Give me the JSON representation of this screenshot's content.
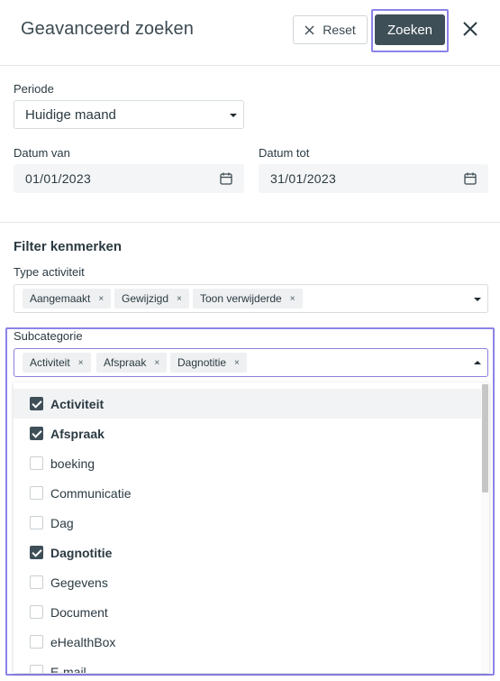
{
  "header": {
    "title": "Geavanceerd zoeken",
    "reset_label": "Reset",
    "search_label": "Zoeken"
  },
  "period": {
    "label": "Periode",
    "value": "Huidige maand"
  },
  "dates": {
    "from_label": "Datum van",
    "from_value": "01/01/2023",
    "to_label": "Datum tot",
    "to_value": "31/01/2023"
  },
  "filters": {
    "title": "Filter kenmerken",
    "type_label": "Type activiteit",
    "type_chips": [
      "Aangemaakt",
      "Gewijzigd",
      "Toon verwijderde"
    ],
    "sub_label": "Subcategorie",
    "sub_chips": [
      "Activiteit",
      "Afspraak",
      "Dagnotitie"
    ]
  },
  "options": [
    {
      "label": "Activiteit",
      "checked": true,
      "highlighted": true
    },
    {
      "label": "Afspraak",
      "checked": true,
      "highlighted": false
    },
    {
      "label": "boeking",
      "checked": false,
      "highlighted": false
    },
    {
      "label": "Communicatie",
      "checked": false,
      "highlighted": false
    },
    {
      "label": "Dag",
      "checked": false,
      "highlighted": false
    },
    {
      "label": "Dagnotitie",
      "checked": true,
      "highlighted": false
    },
    {
      "label": "Gegevens",
      "checked": false,
      "highlighted": false
    },
    {
      "label": "Document",
      "checked": false,
      "highlighted": false
    },
    {
      "label": "eHealthBox",
      "checked": false,
      "highlighted": false
    },
    {
      "label": "E-mail",
      "checked": false,
      "highlighted": false
    }
  ],
  "icons": {
    "reset": "close-icon",
    "close": "close-icon",
    "calendar": "calendar-icon",
    "chip_remove": "×"
  },
  "colors": {
    "primary_button": "#3f4f58",
    "focus_outline": "#8b83e8"
  }
}
